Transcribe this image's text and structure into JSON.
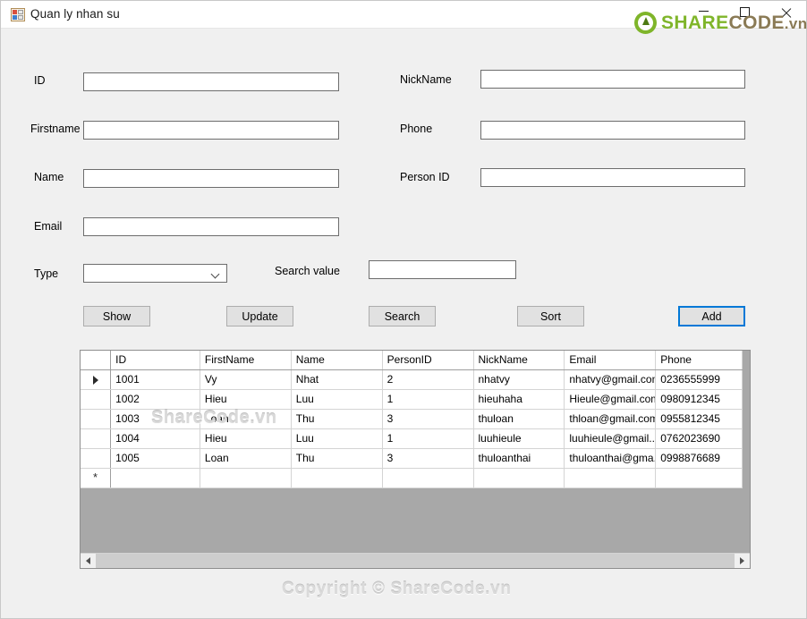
{
  "window": {
    "title": "Quan ly nhan su",
    "icon": "form-app-icon",
    "controls": {
      "minimize": "–",
      "maximize": "□",
      "close": "✕"
    }
  },
  "branding": {
    "logo_share": "SHARE",
    "logo_code": "CODE",
    "logo_vn": ".vn",
    "logo_green": "#7fb52a",
    "logo_brown": "#8a7a55",
    "watermark_grid": "ShareCode.vn",
    "watermark_bottom": "Copyright © ShareCode.vn"
  },
  "form": {
    "left": [
      {
        "label": "ID",
        "value": "",
        "name": "id"
      },
      {
        "label": "Firstname",
        "value": "",
        "name": "firstname"
      },
      {
        "label": "Name",
        "value": "",
        "name": "name"
      },
      {
        "label": "Email",
        "value": "",
        "name": "email"
      }
    ],
    "right": [
      {
        "label": "NickName",
        "value": "",
        "name": "nickname"
      },
      {
        "label": "Phone",
        "value": "",
        "name": "phone"
      },
      {
        "label": "Person ID",
        "value": "",
        "name": "personid"
      }
    ],
    "type": {
      "label": "Type",
      "selected": "",
      "options": []
    },
    "search": {
      "label": "Search value",
      "value": ""
    }
  },
  "buttons": {
    "show": "Show",
    "update": "Update",
    "search": "Search",
    "sort": "Sort",
    "add": "Add",
    "focus_color": "#0078d7"
  },
  "grid": {
    "columns": [
      "ID",
      "FirstName",
      "Name",
      "PersonID",
      "NickName",
      "Email",
      "Phone"
    ],
    "selection_color": "#0c7cd5",
    "selected_row": 0,
    "selected_cell": "ID",
    "rows": [
      {
        "ID": "1001",
        "FirstName": "Vy",
        "Name": "Nhat",
        "PersonID": "2",
        "NickName": "nhatvy",
        "Email": "nhatvy@gmail.com",
        "Phone": "0236555999"
      },
      {
        "ID": "1002",
        "FirstName": "Hieu",
        "Name": "Luu",
        "PersonID": "1",
        "NickName": "hieuhaha",
        "Email": "Hieule@gmail.com",
        "Phone": "0980912345"
      },
      {
        "ID": "1003",
        "FirstName": "Loan",
        "Name": "Thu",
        "PersonID": "3",
        "NickName": "thuloan",
        "Email": "thloan@gmail.com",
        "Phone": "0955812345"
      },
      {
        "ID": "1004",
        "FirstName": "Hieu",
        "Name": "Luu",
        "PersonID": "1",
        "NickName": "luuhieule",
        "Email": "luuhieule@gmail....",
        "Phone": "0762023690"
      },
      {
        "ID": "1005",
        "FirstName": "Loan",
        "Name": "Thu",
        "PersonID": "3",
        "NickName": "thuloanthai",
        "Email": "thuloanthai@gma...",
        "Phone": "0998876689"
      }
    ],
    "new_row_indicator": "*",
    "current_row_indicator": "▶"
  }
}
